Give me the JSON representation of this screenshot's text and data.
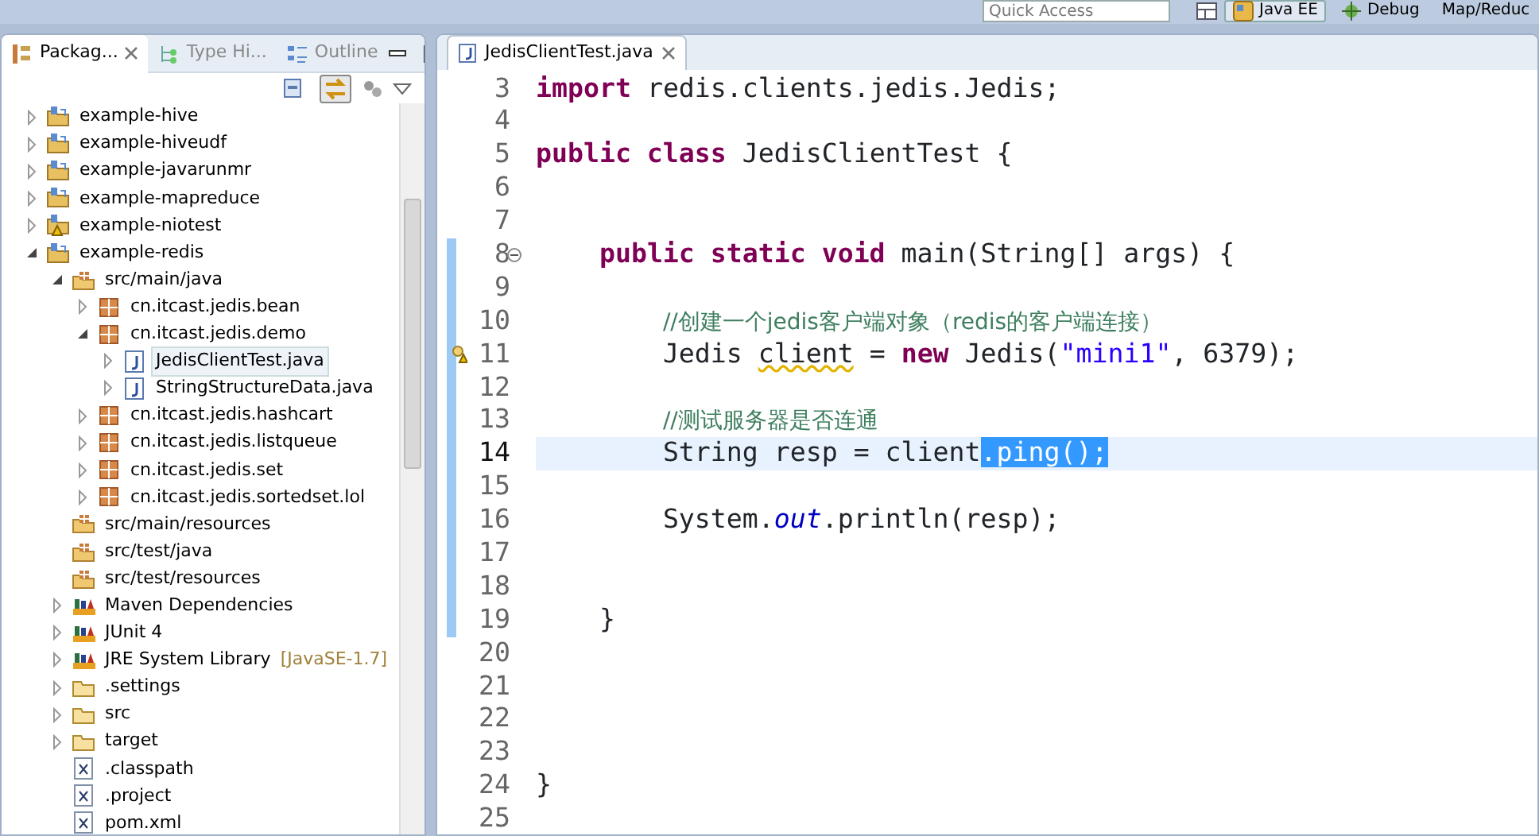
{
  "top_bar": {
    "quick_access": {
      "placeholder": "Quick Access"
    },
    "perspectives": [
      {
        "label": "Java EE",
        "selected": true
      },
      {
        "label": "Debug",
        "selected": false
      },
      {
        "label": "Map/Reduc",
        "selected": false
      }
    ]
  },
  "explorer": {
    "tabs": [
      {
        "label": "Packag...",
        "selected": true
      },
      {
        "label": "Type Hi...",
        "selected": false
      },
      {
        "label": "Outline",
        "selected": false
      }
    ],
    "link_with_editor": true,
    "tree": [
      {
        "label": "example-hive",
        "kind": "project",
        "expanded": false,
        "selected": false
      },
      {
        "label": "example-hiveudf",
        "kind": "project",
        "expanded": false,
        "selected": false
      },
      {
        "label": "example-javarunmr",
        "kind": "project",
        "expanded": false,
        "selected": false
      },
      {
        "label": "example-mapreduce",
        "kind": "project",
        "expanded": false,
        "selected": false
      },
      {
        "label": "example-niotest",
        "kind": "project-warning",
        "expanded": false,
        "selected": false
      },
      {
        "label": "example-redis",
        "kind": "project",
        "expanded": true,
        "selected": false,
        "children": [
          {
            "label": "src/main/java",
            "kind": "source",
            "expanded": true,
            "selected": false,
            "children": [
              {
                "label": "cn.itcast.jedis.bean",
                "kind": "package",
                "expanded": false,
                "selected": false
              },
              {
                "label": "cn.itcast.jedis.demo",
                "kind": "package",
                "expanded": true,
                "selected": false,
                "children": [
                  {
                    "label": "JedisClientTest.java",
                    "kind": "java",
                    "expanded": false,
                    "selected": true
                  },
                  {
                    "label": "StringStructureData.java",
                    "kind": "java",
                    "expanded": false,
                    "selected": false
                  }
                ]
              },
              {
                "label": "cn.itcast.jedis.hashcart",
                "kind": "package",
                "expanded": false,
                "selected": false
              },
              {
                "label": "cn.itcast.jedis.listqueue",
                "kind": "package",
                "expanded": false,
                "selected": false
              },
              {
                "label": "cn.itcast.jedis.set",
                "kind": "package",
                "expanded": false,
                "selected": false
              },
              {
                "label": "cn.itcast.jedis.sortedset.lol",
                "kind": "package",
                "expanded": false,
                "selected": false
              }
            ]
          },
          {
            "label": "src/main/resources",
            "kind": "source",
            "selected": false
          },
          {
            "label": "src/test/java",
            "kind": "source",
            "selected": false
          },
          {
            "label": "src/test/resources",
            "kind": "source",
            "selected": false
          },
          {
            "label": "Maven Dependencies",
            "kind": "library",
            "expanded": false,
            "selected": false
          },
          {
            "label": "JUnit 4",
            "kind": "library",
            "expanded": false,
            "selected": false
          },
          {
            "label": "JRE System Library",
            "decoration": "[JavaSE-1.7]",
            "kind": "library",
            "expanded": false,
            "selected": false
          },
          {
            "label": ".settings",
            "kind": "folder",
            "expanded": false,
            "selected": false
          },
          {
            "label": "src",
            "kind": "folder",
            "expanded": false,
            "selected": false
          },
          {
            "label": "target",
            "kind": "folder",
            "expanded": false,
            "selected": false
          },
          {
            "label": ".classpath",
            "kind": "xml",
            "selected": false
          },
          {
            "label": ".project",
            "kind": "xml",
            "selected": false
          },
          {
            "label": "pom.xml",
            "kind": "xml",
            "selected": false
          }
        ]
      }
    ]
  },
  "editor": {
    "tab": {
      "label": "JedisClientTest.java",
      "selected": true
    },
    "lines": [
      {
        "number": "3",
        "changed": false,
        "current": false,
        "tokens": [
          {
            "kind": "keyword",
            "text": "import"
          },
          {
            "kind": "plain",
            "text": " redis.clients.jedis.Jedis;"
          }
        ]
      },
      {
        "number": "4",
        "changed": false,
        "current": false
      },
      {
        "number": "5",
        "changed": false,
        "current": false,
        "tokens": [
          {
            "kind": "keyword",
            "text": "public class"
          },
          {
            "kind": "plain",
            "text": " JedisClientTest {"
          }
        ]
      },
      {
        "number": "6",
        "changed": false,
        "current": false
      },
      {
        "number": "7",
        "changed": false,
        "current": false
      },
      {
        "number": "8",
        "changed": true,
        "current": false,
        "fold": true,
        "tokens": [
          {
            "kind": "keyword",
            "text": "    public static void"
          },
          {
            "kind": "plain",
            "text": " main(String[] args) {"
          }
        ]
      },
      {
        "number": "9",
        "changed": true,
        "current": false
      },
      {
        "number": "10",
        "changed": true,
        "current": false,
        "tokens": [
          {
            "kind": "comment",
            "text": "        //创建一个jedis客户端对象（redis的客户端连接）"
          }
        ]
      },
      {
        "number": "11",
        "changed": true,
        "current": false,
        "warning": true,
        "tokens": [
          {
            "kind": "plain",
            "text": "        Jedis "
          },
          {
            "kind": "warned",
            "text": "client"
          },
          {
            "kind": "plain",
            "text": " = "
          },
          {
            "kind": "keyword",
            "text": "new"
          },
          {
            "kind": "plain",
            "text": " Jedis("
          },
          {
            "kind": "string",
            "text": "\"mini1\""
          },
          {
            "kind": "plain",
            "text": ", 6379);"
          }
        ]
      },
      {
        "number": "12",
        "changed": true,
        "current": false
      },
      {
        "number": "13",
        "changed": true,
        "current": false,
        "tokens": [
          {
            "kind": "comment",
            "text": "        //测试服务器是否连通"
          }
        ]
      },
      {
        "number": "14",
        "changed": true,
        "current": true,
        "tokens": [
          {
            "kind": "plain",
            "text": "        String resp = client"
          },
          {
            "kind": "selected",
            "text": ".ping();"
          }
        ]
      },
      {
        "number": "15",
        "changed": true,
        "current": false
      },
      {
        "number": "16",
        "changed": true,
        "current": false,
        "tokens": [
          {
            "kind": "plain",
            "text": "        System."
          },
          {
            "kind": "field",
            "text": "out"
          },
          {
            "kind": "plain",
            "text": ".println(resp);"
          }
        ]
      },
      {
        "number": "17",
        "changed": true,
        "current": false
      },
      {
        "number": "18",
        "changed": true,
        "current": false
      },
      {
        "number": "19",
        "changed": true,
        "current": false,
        "tokens": [
          {
            "kind": "plain",
            "text": "    }"
          }
        ]
      },
      {
        "number": "20",
        "changed": false,
        "current": false
      },
      {
        "number": "21",
        "changed": false,
        "current": false
      },
      {
        "number": "22",
        "changed": false,
        "current": false
      },
      {
        "number": "23",
        "changed": false,
        "current": false
      },
      {
        "number": "24",
        "changed": false,
        "current": false,
        "tokens": [
          {
            "kind": "plain",
            "text": "}"
          }
        ]
      },
      {
        "number": "25",
        "changed": false,
        "current": false
      }
    ]
  }
}
